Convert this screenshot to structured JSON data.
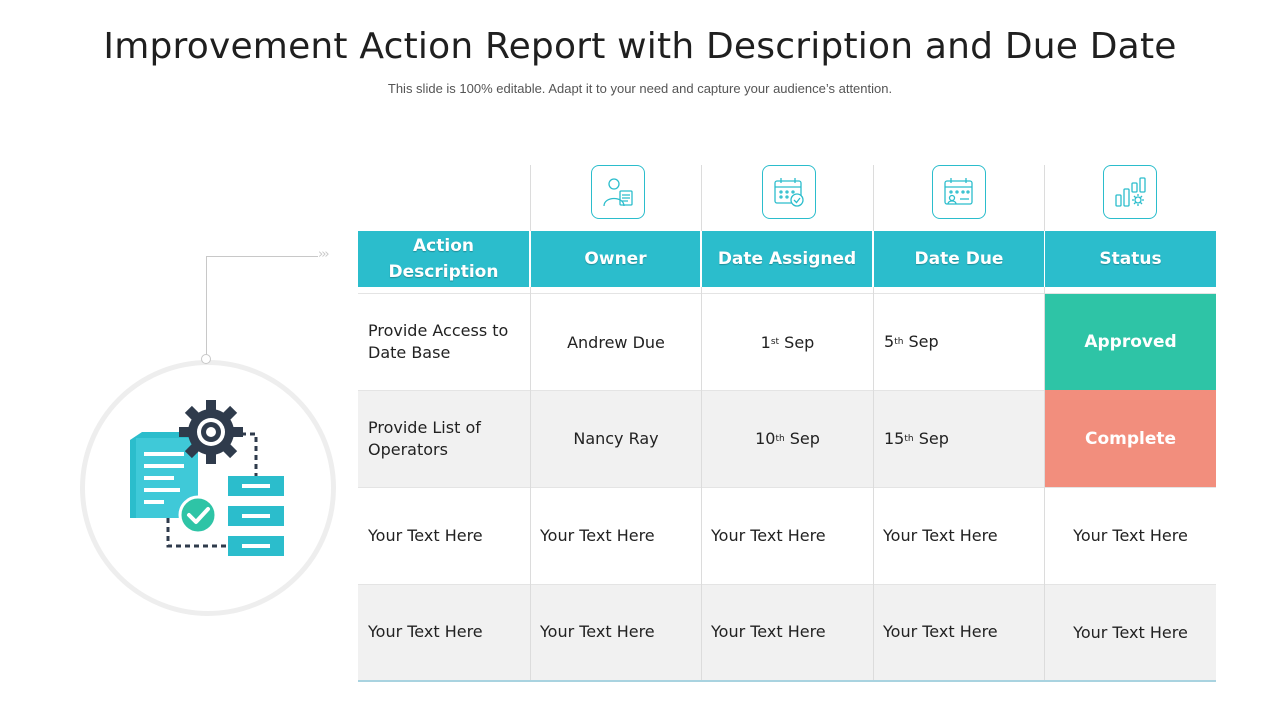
{
  "title": "Improvement Action Report with Description and Due Date",
  "subtitle": "This slide is 100% editable. Adapt it to your need and capture your audience’s attention.",
  "colors": {
    "header": "#2bbdcc",
    "approved": "#2ec4a6",
    "complete": "#f28e7d",
    "row_alt": "#f1f1f1"
  },
  "columns": {
    "action": "Action Description",
    "owner": "Owner",
    "assigned": "Date Assigned",
    "due": "Date Due",
    "status": "Status"
  },
  "column_icons": [
    "owner-profile-icon",
    "calendar-check-icon",
    "calendar-user-icon",
    "bar-chart-gear-icon"
  ],
  "rows": [
    {
      "action": "Provide Access to Date Base",
      "owner": "Andrew Due",
      "assigned_day": "1",
      "assigned_sup": "st",
      "assigned_month": "Sep",
      "due_day": "5",
      "due_sup": "th",
      "due_month": "Sep",
      "status": "Approved"
    },
    {
      "action": "Provide List of Operators",
      "owner": "Nancy Ray",
      "assigned_day": "10",
      "assigned_sup": "th",
      "assigned_month": "Sep",
      "due_day": "15",
      "due_sup": "th",
      "due_month": "Sep",
      "status": "Complete"
    },
    {
      "action": "Your Text Here",
      "owner": "Your Text Here",
      "assigned": "Your Text Here",
      "due": "Your Text Here",
      "status": "Your Text Here"
    },
    {
      "action": "Your Text Here",
      "owner": "Your Text Here",
      "assigned": "Your Text Here",
      "due": "Your Text Here",
      "status": "Your Text Here"
    }
  ]
}
